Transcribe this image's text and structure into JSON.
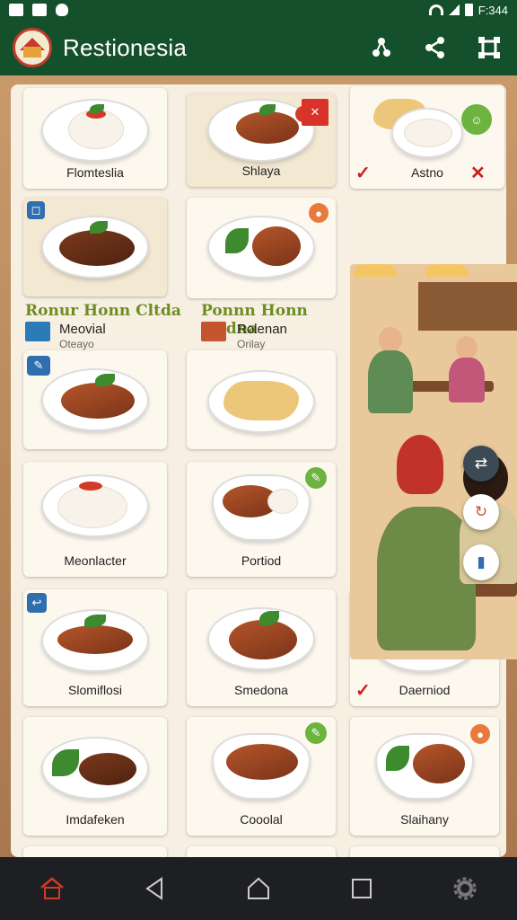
{
  "status_bar": {
    "time": "F:344"
  },
  "app_bar": {
    "title": "Restionesia",
    "actions": [
      "connect-icon",
      "share-icon",
      "expand-icon"
    ]
  },
  "menu": {
    "items": [
      {
        "id": "c1",
        "name": "Flomteslia"
      },
      {
        "id": "c2",
        "name": "Shlaya"
      },
      {
        "id": "c3",
        "name": "Astno"
      },
      {
        "id": "c4",
        "name": ""
      },
      {
        "id": "c5",
        "name": ""
      },
      {
        "id": "c6",
        "name": "Meonlacter"
      },
      {
        "id": "c7",
        "name": "Portiod"
      },
      {
        "id": "c8",
        "name": "Slomiflosi"
      },
      {
        "id": "c9",
        "name": "Smedona"
      },
      {
        "id": "c10",
        "name": "Daerniod"
      },
      {
        "id": "c11",
        "name": "Imdafeken"
      },
      {
        "id": "c12",
        "name": "Cooolal"
      },
      {
        "id": "c13",
        "name": "Slaihany"
      }
    ]
  },
  "promos": [
    {
      "title": "Ronur Honn Cltda",
      "name": "Meovial",
      "sub": "Oteayo"
    },
    {
      "title": "Ponnn Honn Cltdna",
      "name": "Rolenan",
      "sub": "Orilay"
    }
  ],
  "fabs": [
    "swap-icon",
    "refresh-icon",
    "info-icon"
  ],
  "colors": {
    "brand_green": "#15502c",
    "accent_red": "#c53b2a",
    "badge_green": "#6db33f"
  }
}
